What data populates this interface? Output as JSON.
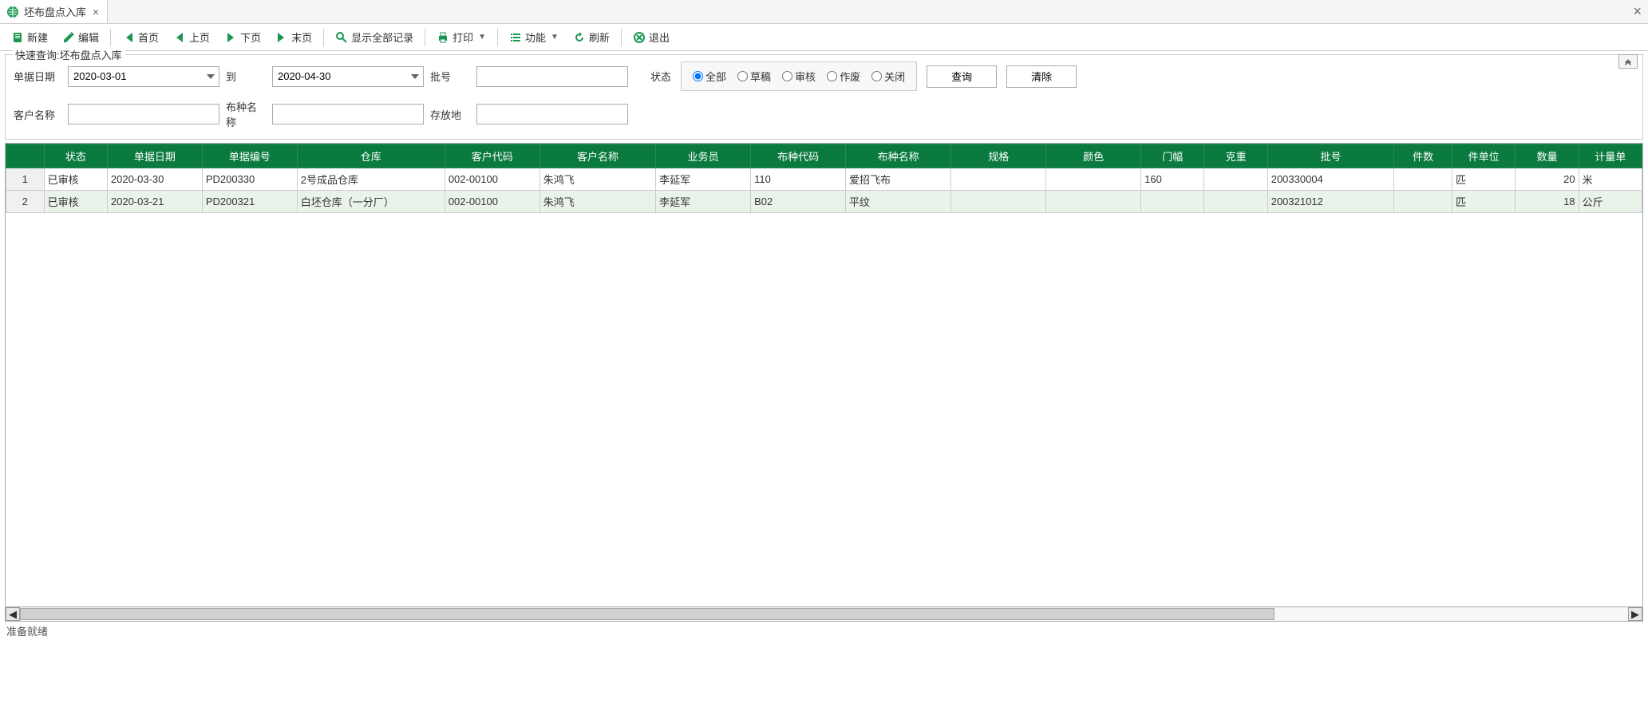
{
  "tab": {
    "title": "坯布盘点入库"
  },
  "toolbar": {
    "new": "新建",
    "edit": "编辑",
    "first": "首页",
    "prev": "上页",
    "next": "下页",
    "last": "末页",
    "show_all": "显示全部记录",
    "print": "打印",
    "func": "功能",
    "refresh": "刷新",
    "exit": "退出"
  },
  "query": {
    "title": "快速查询:坯布盘点入库",
    "labels": {
      "bill_date": "单据日期",
      "to": "到",
      "batch": "批号",
      "status": "状态",
      "customer": "客户名称",
      "fabric": "布种名称",
      "storage": "存放地"
    },
    "values": {
      "date_from": "2020-03-01",
      "date_to": "2020-04-30",
      "batch": "",
      "customer": "",
      "fabric": "",
      "storage": ""
    },
    "status_options": {
      "all": "全部",
      "draft": "草稿",
      "audit": "审核",
      "void": "作废",
      "closed": "关闭"
    },
    "buttons": {
      "search": "查询",
      "clear": "清除"
    }
  },
  "table": {
    "columns": [
      "",
      "状态",
      "单据日期",
      "单据编号",
      "仓库",
      "客户代码",
      "客户名称",
      "业务员",
      "布种代码",
      "布种名称",
      "规格",
      "颜色",
      "门幅",
      "克重",
      "批号",
      "件数",
      "件单位",
      "数量",
      "计量单"
    ],
    "rows": [
      {
        "n": "1",
        "status": "已审核",
        "date": "2020-03-30",
        "bill": "PD200330",
        "wh": "2号成品仓库",
        "ccode": "002-00100",
        "cname": "朱鸿飞",
        "sales": "李延军",
        "fcode": "110",
        "fname": "爱招飞布",
        "spec": "",
        "color": "",
        "width": "160",
        "weight": "",
        "batch": "200330004",
        "pcs": "",
        "punit": "匹",
        "qty": "20",
        "unit": "米"
      },
      {
        "n": "2",
        "status": "已审核",
        "date": "2020-03-21",
        "bill": "PD200321",
        "wh": "白坯仓库（一分厂）",
        "ccode": "002-00100",
        "cname": "朱鸿飞",
        "sales": "李延军",
        "fcode": "B02",
        "fname": "平纹",
        "spec": "",
        "color": "",
        "width": "",
        "weight": "",
        "batch": "200321012",
        "pcs": "",
        "punit": "匹",
        "qty": "18",
        "unit": "公斤"
      }
    ]
  },
  "status_bar": "准备就绪"
}
